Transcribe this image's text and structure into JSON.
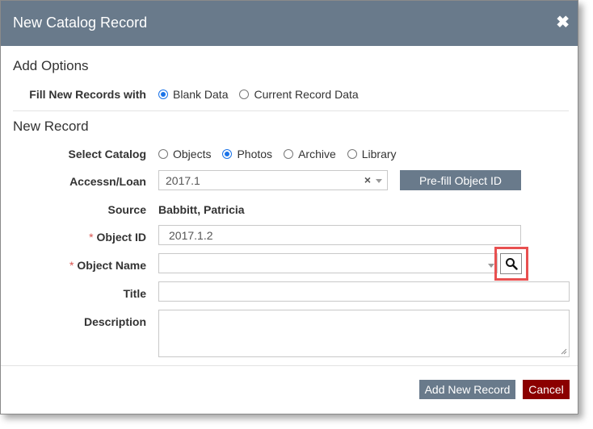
{
  "dialog": {
    "title": "New Catalog Record",
    "close_glyph": "✖"
  },
  "add_options": {
    "heading": "Add Options",
    "fill_label": "Fill New Records with",
    "options": [
      "Blank Data",
      "Current Record Data"
    ],
    "selected": "Blank Data"
  },
  "new_record": {
    "heading": "New Record",
    "catalog_label": "Select Catalog",
    "catalogs": [
      "Objects",
      "Photos",
      "Archive",
      "Library"
    ],
    "selected_catalog": "Photos",
    "accession_label": "Accessn/Loan",
    "accession_value": "2017.1",
    "accession_clear": "×",
    "prefill_button": "Pre-fill Object ID",
    "source_label": "Source",
    "source_value": "Babbitt, Patricia",
    "required_marker": "*",
    "object_id_label": "Object ID",
    "object_id_value": "2017.1.2",
    "object_name_label": "Object Name",
    "object_name_value": "",
    "title_label": "Title",
    "title_value": "",
    "description_label": "Description",
    "description_value": ""
  },
  "footer": {
    "add_button": "Add New Record",
    "cancel_button": "Cancel"
  },
  "colors": {
    "titlebar": "#697a8b",
    "button": "#697a8b",
    "cancel": "#8b0000",
    "highlight": "#e85050",
    "radio_accent": "#1a73e8"
  }
}
